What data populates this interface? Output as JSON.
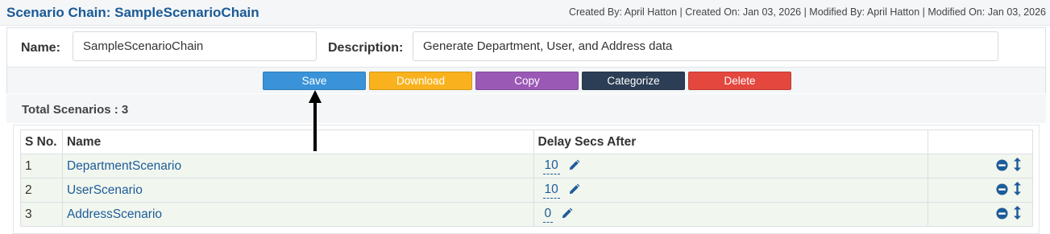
{
  "header": {
    "title": "Scenario Chain: SampleScenarioChain",
    "meta": "Created By: April Hatton | Created On: Jan 03, 2026 | Modified By: April Hatton | Modified On: Jan 03, 2026"
  },
  "form": {
    "name_label": "Name:",
    "name_value": "SampleScenarioChain",
    "description_label": "Description:",
    "description_value": "Generate Department, User, and Address data"
  },
  "toolbar": {
    "save_label": "Save",
    "download_label": "Download",
    "copy_label": "Copy",
    "categorize_label": "Categorize",
    "delete_label": "Delete"
  },
  "summary": {
    "total_label": "Total Scenarios : 3"
  },
  "table": {
    "headers": [
      "S No.",
      "Name",
      "Delay Secs After",
      ""
    ],
    "rows": [
      {
        "sno": "1",
        "name": "DepartmentScenario",
        "delay": "10"
      },
      {
        "sno": "2",
        "name": "UserScenario",
        "delay": "10"
      },
      {
        "sno": "3",
        "name": "AddressScenario",
        "delay": "0"
      }
    ]
  },
  "icons": {
    "edit": "pencil-icon",
    "remove": "minus-circle-icon",
    "reorder": "vertical-arrows-icon",
    "annotation": "up-arrow-icon"
  },
  "colors": {
    "accent": "#1a5a96",
    "save": "#3a93d8",
    "download": "#f9b21d",
    "copy": "#9b59b6",
    "categorize": "#2c3e55",
    "delete": "#e3473e",
    "row_bg": "#f1f6ef"
  }
}
